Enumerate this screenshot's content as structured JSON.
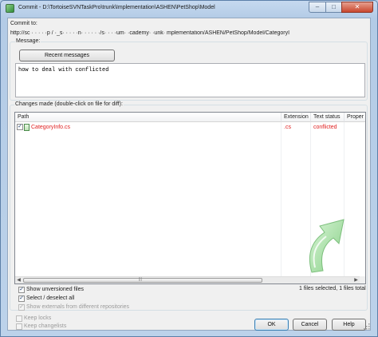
{
  "window": {
    "title": "Commit - D:\\TortoiseSVNTaskPro\\trunk\\Implementation\\ASHEN\\PetShop\\Model",
    "minimize_glyph": "–",
    "maximize_glyph": "□",
    "close_glyph": "✕"
  },
  "commit_to": {
    "label": "Commit to:",
    "url": "http://sc     · · · · ·p /  ·_s· · · · ·n· · · · · ·/s· · · ·um· ·cademy· ·unk· mplementation/ASHEN/PetShop/Model/CategoryI"
  },
  "message": {
    "label": "Message:",
    "recent_button": "Recent messages",
    "text": "how to deal with conflicted"
  },
  "changes": {
    "label": "Changes made (double-click on file for diff):",
    "columns": [
      "Path",
      "Extension",
      "Text status",
      "Proper"
    ],
    "rows": [
      {
        "checked": true,
        "path": "CategoryInfo.cs",
        "extension": ".cs",
        "text_status": "conflicted"
      }
    ],
    "status_text": "1 files selected, 1 files total",
    "scroll_left_glyph": "◀",
    "scroll_right_glyph": "▶",
    "thumb_grip": "|||"
  },
  "options": {
    "show_unversioned": {
      "label": "Show unversioned files",
      "checked": true
    },
    "select_deselect": {
      "label": "Select / deselect all",
      "checked": true
    },
    "show_externals": {
      "label": "Show externals from different repositories",
      "checked": true,
      "disabled": true
    },
    "keep_locks": {
      "label": "Keep locks",
      "checked": false,
      "disabled": true
    },
    "keep_changelists": {
      "label": "Keep changelists",
      "checked": false,
      "disabled": true
    }
  },
  "buttons": {
    "ok": "OK",
    "cancel": "Cancel",
    "help": "Help"
  },
  "check_glyph": "✓",
  "colors": {
    "conflicted": "#e02020",
    "watermark_arrow": "#9bdf9b",
    "titlebar": "#c6d9ef",
    "close_button": "#c9472e"
  },
  "icons": [
    "app-icon",
    "file-icon",
    "commit-arrow-watermark-icon",
    "resize-grip-icon"
  ]
}
